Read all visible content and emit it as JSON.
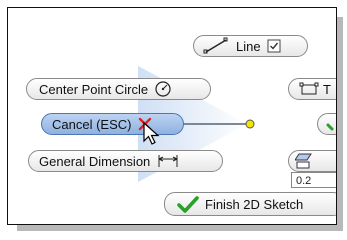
{
  "marking_menu": {
    "line": {
      "label": "Line",
      "icon": "line-icon",
      "checkbox": "checkbox-icon"
    },
    "center_point_circle": {
      "label": "Center Point Circle",
      "icon": "circle-icon"
    },
    "cancel": {
      "label": "Cancel (ESC)",
      "icon": "close-icon",
      "icon_color": "#e02020"
    },
    "general_dimension": {
      "label": "General Dimension",
      "icon": "dimension-icon"
    },
    "finish_sketch": {
      "label": "Finish 2D Sketch",
      "icon": "checkmark-icon",
      "icon_color": "#2aa02a"
    },
    "partial_right_labels": {
      "rectangle": "T",
      "hatch_value": "0.2"
    }
  },
  "colors": {
    "selected": "#a6c2ea",
    "center_dot": "#f2e600"
  }
}
